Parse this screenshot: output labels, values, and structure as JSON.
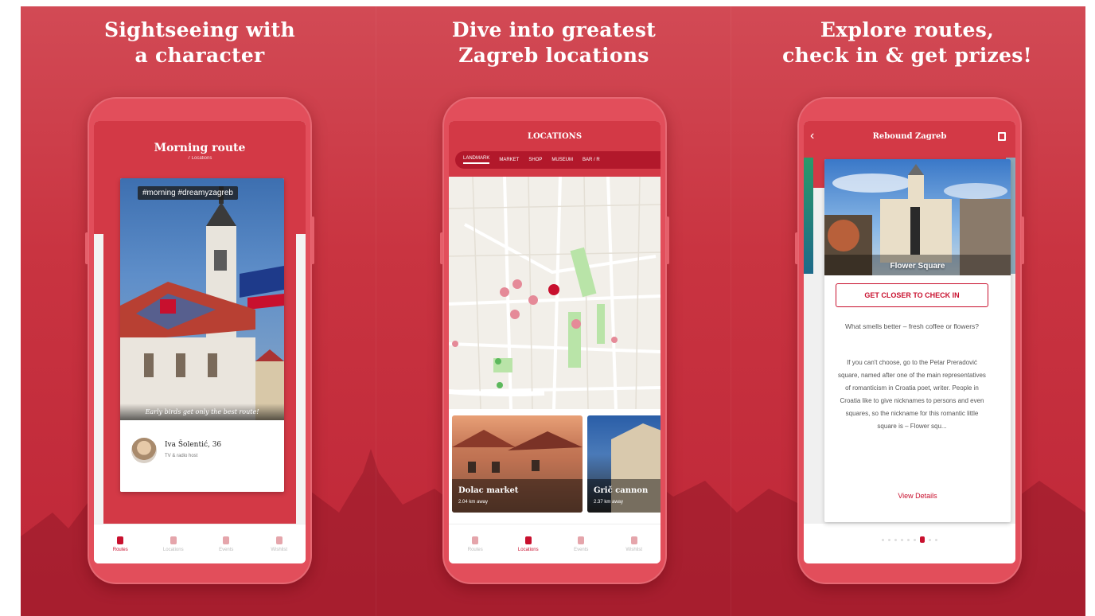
{
  "panels": [
    {
      "headline_line1": "Sightseeing with",
      "headline_line2": "a character"
    },
    {
      "headline_line1": "Dive into greatest",
      "headline_line2": "Zagreb locations"
    },
    {
      "headline_line1": "Explore routes,",
      "headline_line2": "check in & get prizes!"
    }
  ],
  "colors": {
    "brand": "#d33946",
    "accent": "#c8102e",
    "background": "#c93441"
  },
  "phone1": {
    "title": "Morning route",
    "subtitle": "7 Locations",
    "hashtag": "#morning #dreamyzagreb",
    "caption": "Early birds get only the best route!",
    "author_name": "Iva Šolentić, 36",
    "author_role": "TV & radio host"
  },
  "phone2": {
    "title": "LOCATIONS",
    "tabs": [
      "LANDMARK",
      "MARKET",
      "SHOP",
      "MUSEUM",
      "BAR / R"
    ],
    "cards": [
      {
        "name": "Dolac market",
        "distance": "2.04 km away"
      },
      {
        "name": "Grič cannon",
        "distance": "2.37 km away"
      }
    ]
  },
  "phone3": {
    "title": "Rebound Zagreb",
    "back_icon": "chevron-left-icon",
    "map_icon": "map-icon",
    "photo_title": "Flower Square",
    "checkin_label": "GET CLOSER TO CHECK IN",
    "question": "What smells better – fresh coffee or flowers?",
    "description": "If you can't choose, go to the Petar Preradović square, named after one of the main representatives of romanticism in Croatia poet, writer. People in Croatia like to give nicknames to persons and even squares, so the nickname for this romantic little square is – Flower squ...",
    "view_details": "View Details"
  },
  "bottom_nav": [
    "Routes",
    "Locations",
    "Events",
    "Wishlist"
  ]
}
